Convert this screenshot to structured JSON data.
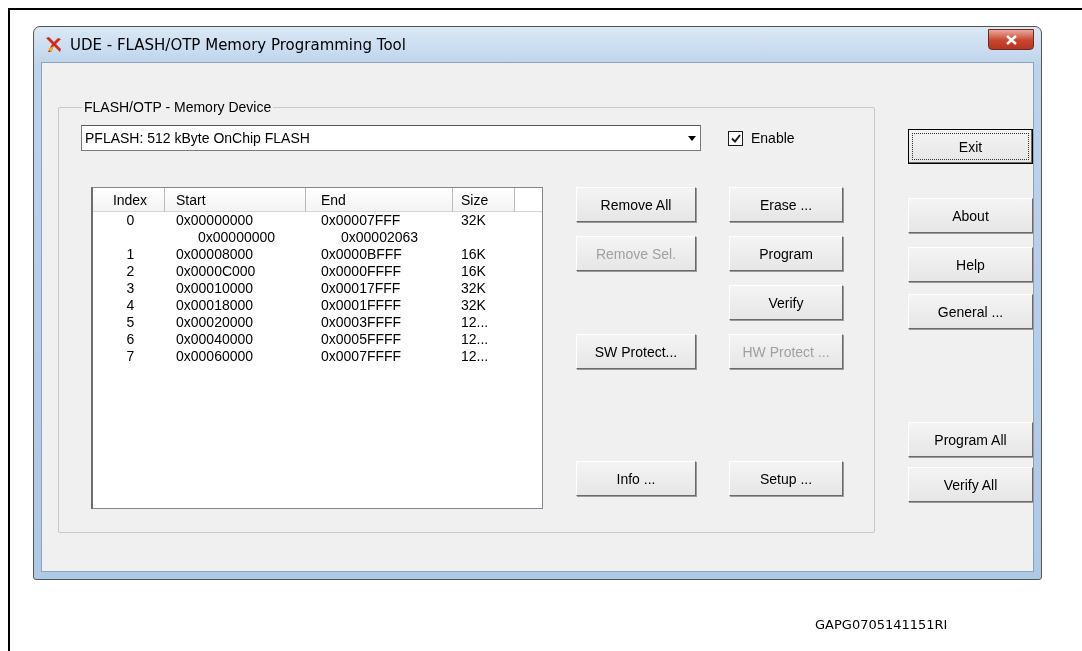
{
  "window": {
    "title": "UDE - FLASH/OTP Memory Programming Tool"
  },
  "group": {
    "title": "FLASH/OTP - Memory Device"
  },
  "device_combo": {
    "value": "PFLASH: 512 kByte OnChip FLASH"
  },
  "enable_checkbox": {
    "label": "Enable",
    "checked": true
  },
  "table": {
    "columns": [
      "Index",
      "Start",
      "End",
      "Size"
    ],
    "rows": [
      {
        "kind": "entry",
        "index": "0",
        "start": "0x00000000",
        "end": "0x00007FFF",
        "size": "32K"
      },
      {
        "kind": "detail",
        "start": "0x00000000",
        "end": "0x00002063"
      },
      {
        "kind": "entry",
        "index": "1",
        "start": "0x00008000",
        "end": "0x0000BFFF",
        "size": "16K"
      },
      {
        "kind": "entry",
        "index": "2",
        "start": "0x0000C000",
        "end": "0x0000FFFF",
        "size": "16K"
      },
      {
        "kind": "entry",
        "index": "3",
        "start": "0x00010000",
        "end": "0x00017FFF",
        "size": "32K"
      },
      {
        "kind": "entry",
        "index": "4",
        "start": "0x00018000",
        "end": "0x0001FFFF",
        "size": "32K"
      },
      {
        "kind": "entry",
        "index": "5",
        "start": "0x00020000",
        "end": "0x0003FFFF",
        "size": "12..."
      },
      {
        "kind": "entry",
        "index": "6",
        "start": "0x00040000",
        "end": "0x0005FFFF",
        "size": "12..."
      },
      {
        "kind": "entry",
        "index": "7",
        "start": "0x00060000",
        "end": "0x0007FFFF",
        "size": "12..."
      }
    ]
  },
  "left_buttons": [
    {
      "label": "Remove All",
      "disabled": false
    },
    {
      "label": "Remove Sel.",
      "disabled": true
    },
    {
      "label": "SW Protect...",
      "disabled": false
    },
    {
      "label": "Info ...",
      "disabled": false
    }
  ],
  "middle_buttons": [
    {
      "label": "Erase ...",
      "disabled": false
    },
    {
      "label": "Program",
      "disabled": false
    },
    {
      "label": "Verify",
      "disabled": false
    },
    {
      "label": "HW Protect ...",
      "disabled": true
    },
    {
      "label": "Setup ...",
      "disabled": false
    }
  ],
  "right_buttons": [
    {
      "label": "Exit",
      "disabled": false,
      "focused": true
    },
    {
      "label": "About",
      "disabled": false,
      "focused": false
    },
    {
      "label": "Help",
      "disabled": false,
      "focused": false
    },
    {
      "label": "General ...",
      "disabled": false,
      "focused": false
    },
    {
      "label": "Program All",
      "disabled": false,
      "focused": false
    },
    {
      "label": "Verify All",
      "disabled": false,
      "focused": false
    }
  ],
  "figure_id": "GAPG0705141151RI"
}
